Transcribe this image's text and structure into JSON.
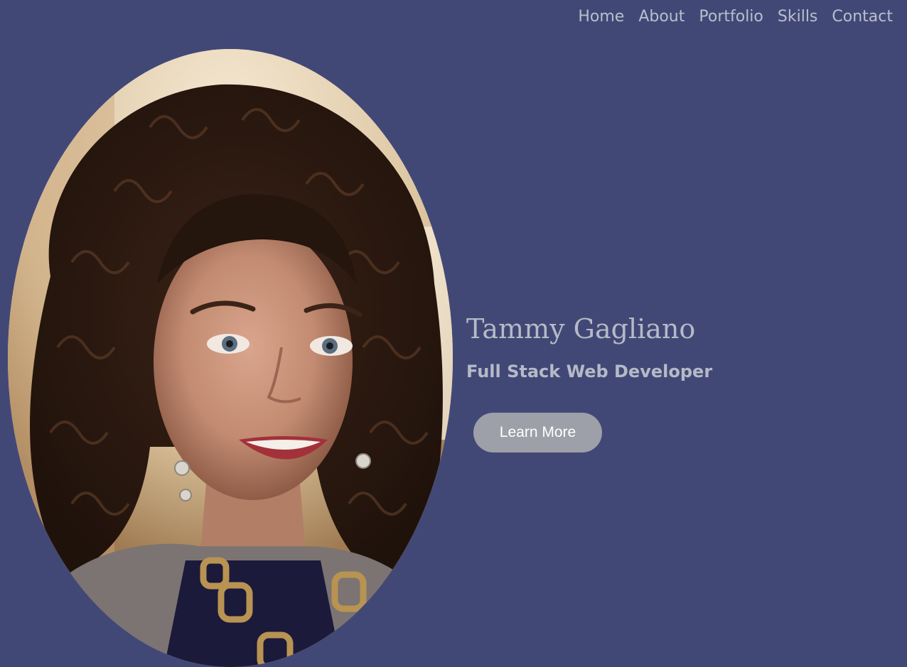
{
  "nav": {
    "items": [
      {
        "label": "Home"
      },
      {
        "label": "About"
      },
      {
        "label": "Portfolio"
      },
      {
        "label": "Skills"
      },
      {
        "label": "Contact"
      }
    ]
  },
  "hero": {
    "name": "Tammy Gagliano",
    "title": "Full Stack Web Developer",
    "button_label": "Learn More"
  },
  "colors": {
    "background": "#424876",
    "nav_text": "#b9bfcc",
    "hero_text": "#b5bac7",
    "button_bg": "#9da0a8",
    "button_text": "#ffffff"
  }
}
